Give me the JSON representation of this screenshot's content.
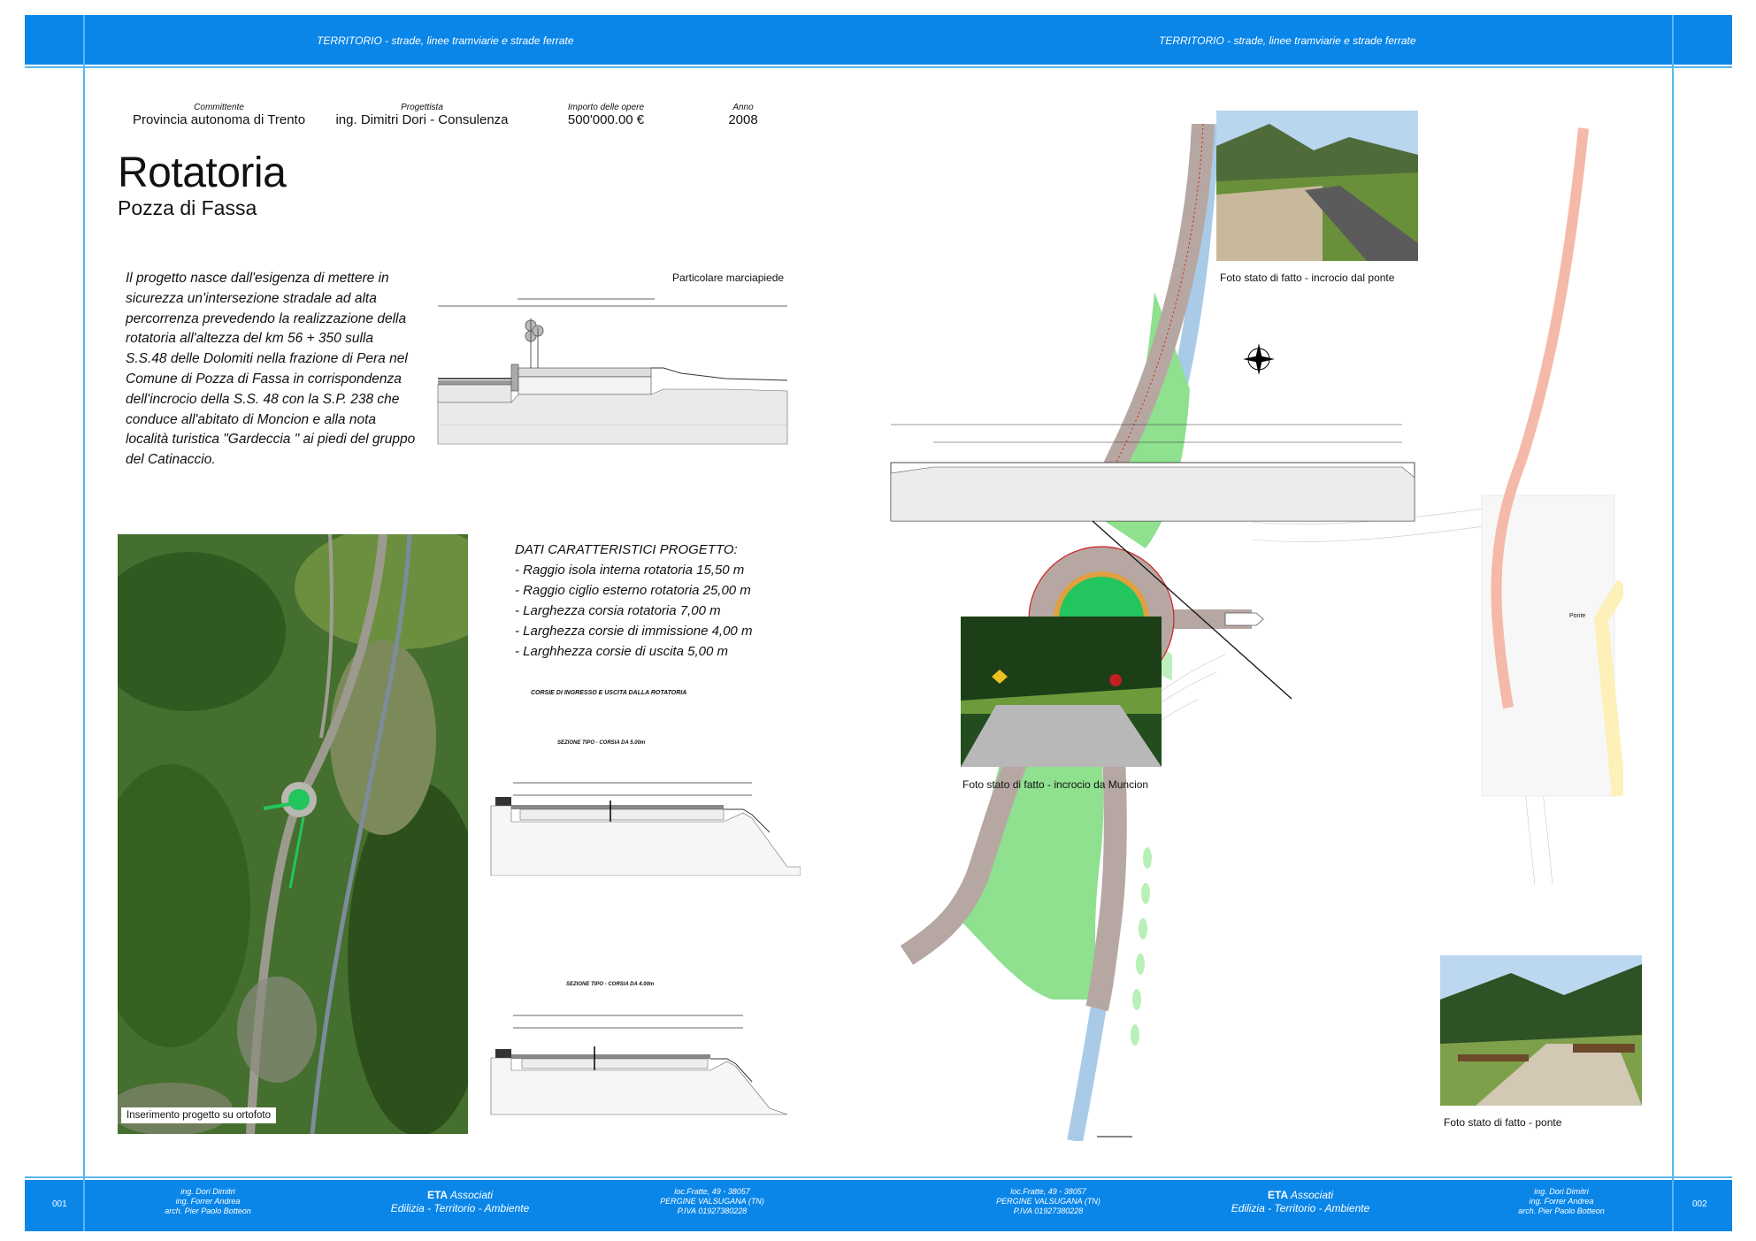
{
  "header": {
    "left_title": "TERRITORIO - strade, linee tramviarie e strade ferrate",
    "right_title": "TERRITORIO - strade, linee tramviarie e strade ferrate"
  },
  "meta": {
    "committente_label": "Committente",
    "committente_value": "Provincia autonoma di Trento",
    "progettista_label": "Progettista",
    "progettista_value": "ing. Dimitri Dori - Consulenza",
    "importo_label": "Importo delle opere",
    "importo_value": "500'000.00 €",
    "anno_label": "Anno",
    "anno_value": "2008"
  },
  "title": "Rotatoria",
  "subtitle": "Pozza di Fassa",
  "intro_lines": [
    "Il progetto nasce dall'esigenza di mettere in",
    "sicurezza un'intersezione stradale ad alta",
    "percorrenza prevedendo la realizzazione della",
    "rotatoria all'altezza del km 56 + 350 sulla",
    "S.S.48 delle Dolomiti nella frazione di Pera nel",
    "Comune di Pozza di Fassa in corrispondenza",
    "dell'incrocio della S.S. 48 con la S.P. 238 che",
    "conduce all'abitato di Moncion e alla nota",
    "località turistica \"Gardeccia \" ai piedi del gruppo",
    "del Catinaccio."
  ],
  "marciapiede_caption": "Particolare marciapiede",
  "dati": {
    "heading": "DATI CARATTERISTICI PROGETTO:",
    "items": [
      "- Raggio isola interna rotatoria 15,50 m",
      "- Raggio ciglio esterno rotatoria 25,00 m",
      "- Larghezza corsia rotatoria 7,00 m",
      "- Larghezza corsie di immissione 4,00 m",
      "- Larghhezza corsie di uscita 5,00 m"
    ]
  },
  "sections": {
    "title": "CORSIE DI INGRESSO E USCITA DALLA ROTATORIA",
    "s1_title": "SEZIONE TIPO - CORSIA DA 5.00m",
    "s2_title": "SEZIONE TIPO - CORSIA DA 4.00m"
  },
  "ortofoto_caption": "Inserimento progetto su ortofoto",
  "photos": {
    "ponte_incrocio": "Foto stato di fatto - incrocio dal ponte",
    "moncion": "Foto stato di fatto - incrocio da Muncion",
    "ponte": "Foto stato di fatto - ponte"
  },
  "plan_labels": {
    "ponte": "Ponte"
  },
  "footer": {
    "page_left": "001",
    "page_right": "002",
    "people_lines": [
      "ing. Dori Dimitri",
      "ing. Forrer Andrea",
      "arch. Pier Paolo Botteon"
    ],
    "eta_name": "ETA",
    "eta_rest": " Associati",
    "eta_sub": "Edilizia - Territorio - Ambiente",
    "address_lines": [
      "loc.Fratte, 49 - 38057",
      "PERGINE VALSUGANA (TN)",
      "P.IVA 01927380228"
    ]
  },
  "colors": {
    "band": "#0a86e8",
    "rule": "#58b6f0",
    "roundabout_green": "#22c55e",
    "verge_green": "#8fe08f",
    "road": "#b7a7a2",
    "road_edge": "#d02020"
  }
}
